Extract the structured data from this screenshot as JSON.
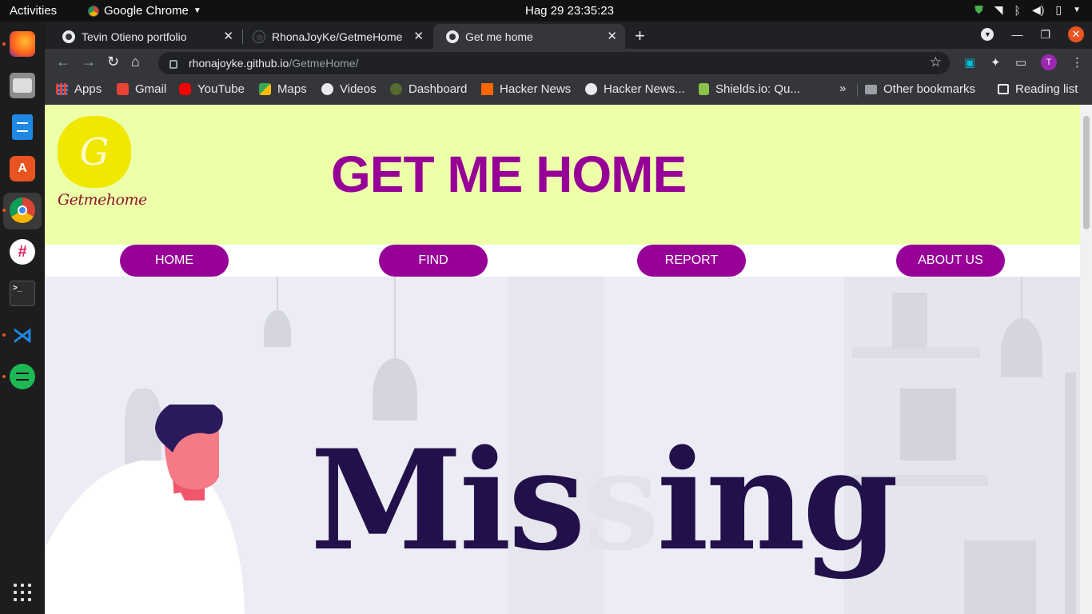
{
  "system": {
    "activities": "Activities",
    "app_name": "Google Chrome",
    "clock": "Hag 29  23:35:23"
  },
  "dock": {
    "apps": [
      "firefox-icon",
      "files-icon",
      "writer-icon",
      "software-icon",
      "chrome-icon",
      "slack-icon",
      "terminal-icon",
      "vscode-icon",
      "spotify-icon"
    ]
  },
  "browser": {
    "tabs": [
      {
        "title": "Tevin Otieno portfolio",
        "active": false
      },
      {
        "title": "RhonaJoyKe/GetmeHome",
        "active": false
      },
      {
        "title": "Get me home",
        "active": true
      }
    ],
    "url_host": "rhonajoyke.github.io",
    "url_path": "/GetmeHome/",
    "profile_initial": "T",
    "bookmarks": [
      {
        "label": "Apps",
        "color": "#4285f4"
      },
      {
        "label": "Gmail",
        "color": "#ea4335"
      },
      {
        "label": "YouTube",
        "color": "#ff0000"
      },
      {
        "label": "Maps",
        "color": "#34a853"
      },
      {
        "label": "Videos",
        "color": "#e8eaed"
      },
      {
        "label": "Dashboard",
        "color": "#6b8e23"
      },
      {
        "label": "Hacker News",
        "color": "#ff6600"
      },
      {
        "label": "Hacker News...",
        "color": "#e8eaed"
      },
      {
        "label": "Shields.io: Qu...",
        "color": "#8bc34a"
      }
    ],
    "more_bookmarks": "»",
    "other_bookmarks": "Other bookmarks",
    "reading_list": "Reading list"
  },
  "site": {
    "logo_letter": "G",
    "logo_text": "Getmehome",
    "title": "GET ME HOME",
    "nav": [
      "HOME",
      "FIND",
      "REPORT",
      "ABOUT US"
    ],
    "hero_word_part1": "Mis",
    "hero_word_ghost": "s",
    "hero_word_part2": "ing",
    "colors": {
      "header_bg": "#eeffaa",
      "accent": "#970097",
      "hero_text": "#22104a"
    }
  }
}
